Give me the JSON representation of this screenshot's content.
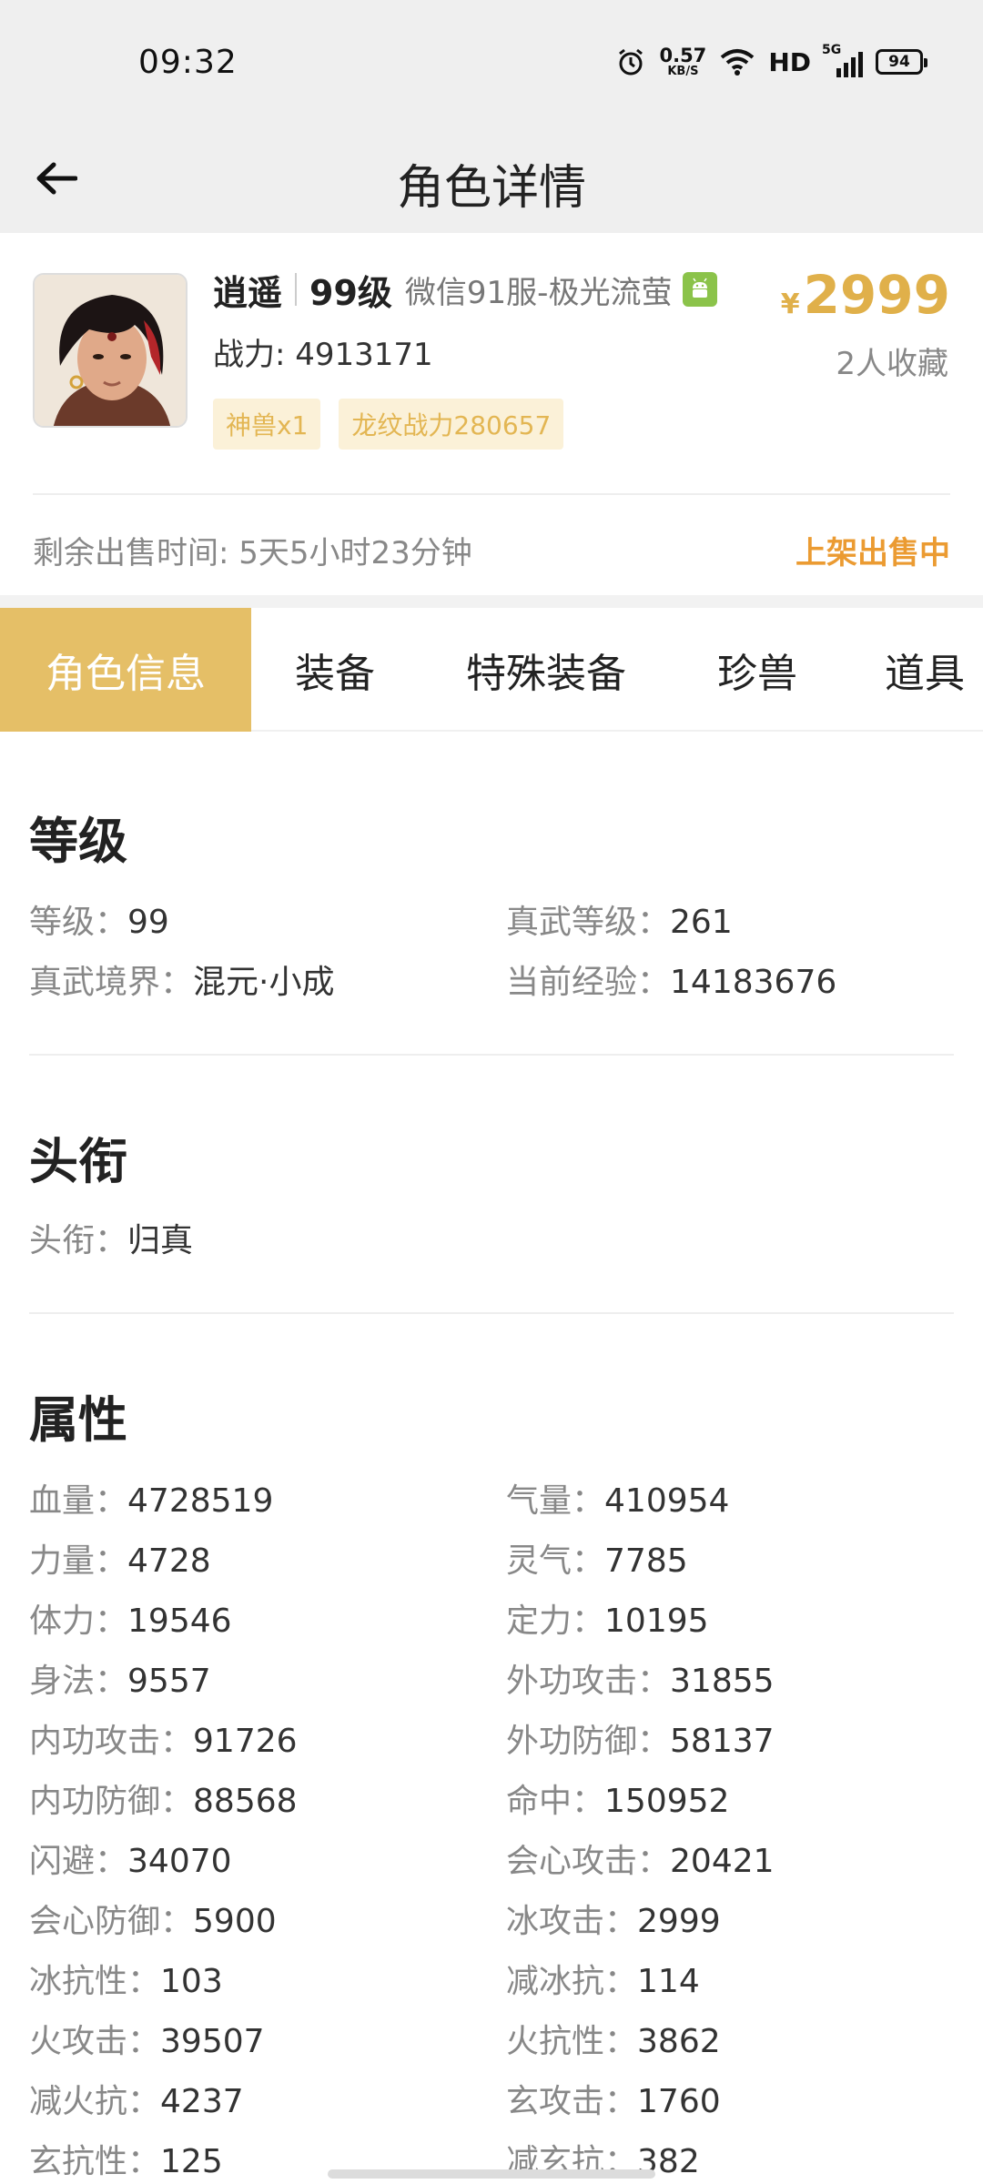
{
  "status_bar": {
    "time": "09:32",
    "net_speed_value": "0.57",
    "net_speed_unit": "KB/S",
    "hd_label": "HD",
    "network_label": "5G",
    "battery": "94"
  },
  "header": {
    "title": "角色详情"
  },
  "product": {
    "name": "逍遥",
    "level": "99级",
    "server": "微信91服-极光流萤",
    "price_symbol": "¥",
    "price": "2999",
    "favorites": "2人收藏",
    "power": "战力: 4913171",
    "tags": [
      "神兽x1",
      "龙纹战力280657"
    ],
    "remaining_time": "剩余出售时间: 5天5小时23分钟",
    "sale_status": "上架出售中"
  },
  "tabs": [
    {
      "label": "角色信息",
      "active": true
    },
    {
      "label": "装备"
    },
    {
      "label": "特殊装备"
    },
    {
      "label": "珍兽"
    },
    {
      "label": "道具"
    }
  ],
  "level_section": {
    "title": "等级",
    "items": [
      {
        "key": "等级：",
        "value": "99"
      },
      {
        "key": "真武等级：",
        "value": "261"
      },
      {
        "key": "真武境界：",
        "value": "混元·小成"
      },
      {
        "key": "当前经验：",
        "value": "14183676"
      }
    ]
  },
  "title_section": {
    "title": "头衔",
    "items": [
      {
        "key": "头衔：",
        "value": "归真"
      }
    ]
  },
  "attributes_section": {
    "title": "属性",
    "items": [
      {
        "key": "血量：",
        "value": "4728519"
      },
      {
        "key": "气量：",
        "value": "410954"
      },
      {
        "key": "力量：",
        "value": "4728"
      },
      {
        "key": "灵气：",
        "value": "7785"
      },
      {
        "key": "体力：",
        "value": "19546"
      },
      {
        "key": "定力：",
        "value": "10195"
      },
      {
        "key": "身法：",
        "value": "9557"
      },
      {
        "key": "外功攻击：",
        "value": "31855"
      },
      {
        "key": "内功攻击：",
        "value": "91726"
      },
      {
        "key": "外功防御：",
        "value": "58137"
      },
      {
        "key": "内功防御：",
        "value": "88568"
      },
      {
        "key": "命中：",
        "value": "150952"
      },
      {
        "key": "闪避：",
        "value": "34070"
      },
      {
        "key": "会心攻击：",
        "value": "20421"
      },
      {
        "key": "会心防御：",
        "value": "5900"
      },
      {
        "key": "冰攻击：",
        "value": "2999"
      },
      {
        "key": "冰抗性：",
        "value": "103"
      },
      {
        "key": "减冰抗：",
        "value": "114"
      },
      {
        "key": "火攻击：",
        "value": "39507"
      },
      {
        "key": "火抗性：",
        "value": "3862"
      },
      {
        "key": "减火抗：",
        "value": "4237"
      },
      {
        "key": "玄攻击：",
        "value": "1760"
      },
      {
        "key": "玄抗性：",
        "value": "125"
      },
      {
        "key": "减玄抗：",
        "value": "382"
      }
    ]
  },
  "colors": {
    "accent_gold": "#e5bf67",
    "price_gold": "#e0b04a",
    "sale_orange": "#eb9b32",
    "tag_bg": "#fbf1d8"
  }
}
